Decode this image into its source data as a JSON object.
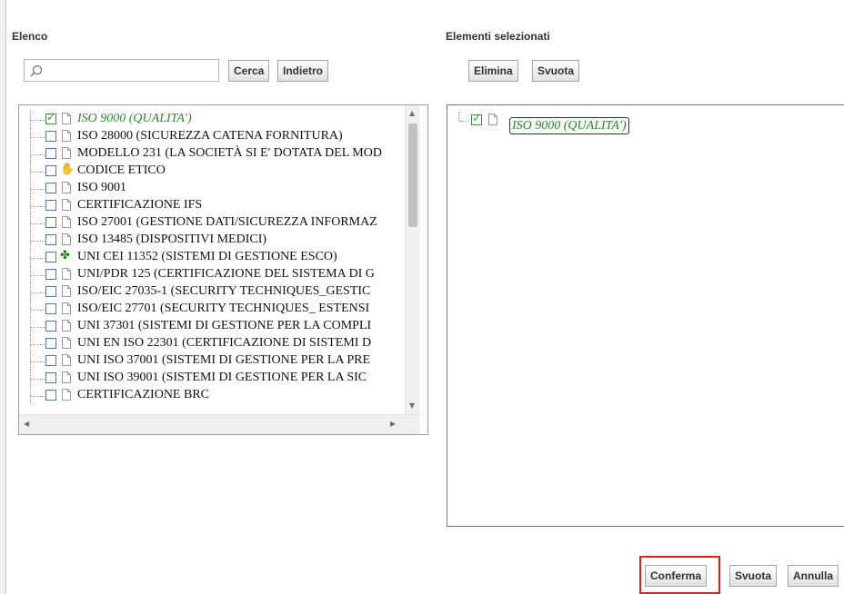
{
  "left_panel": {
    "heading": "Elenco",
    "search": {
      "value": "",
      "placeholder": ""
    },
    "buttons": {
      "search": "Cerca",
      "back": "Indietro"
    },
    "tree_items": [
      {
        "label": "ISO 9000 (QUALITA')",
        "checked": true,
        "icon": "document-icon",
        "selected": true
      },
      {
        "label": "ISO 28000 (SICUREZZA CATENA FORNITURA)",
        "checked": false,
        "icon": "document-icon"
      },
      {
        "label": "MODELLO 231 (LA SOCIETÀ SI E' DOTATA DEL MOD",
        "checked": false,
        "icon": "document-icon"
      },
      {
        "label": "CODICE ETICO",
        "checked": false,
        "icon": "hand-icon"
      },
      {
        "label": "ISO 9001",
        "checked": false,
        "icon": "document-icon"
      },
      {
        "label": "CERTIFICAZIONE IFS",
        "checked": false,
        "icon": "document-icon"
      },
      {
        "label": "ISO 27001 (GESTIONE DATI/SICUREZZA INFORMAZ",
        "checked": false,
        "icon": "document-icon"
      },
      {
        "label": "ISO 13485 (DISPOSITIVI MEDICI)",
        "checked": false,
        "icon": "document-icon"
      },
      {
        "label": "UNI CEI 11352 (SISTEMI DI GESTIONE ESCO)",
        "checked": false,
        "icon": "clover-icon"
      },
      {
        "label": "UNI/PDR 125 (CERTIFICAZIONE DEL SISTEMA DI G",
        "checked": false,
        "icon": "document-icon"
      },
      {
        "label": "ISO/EIC 27035-1 (SECURITY TECHNIQUES_GESTIC",
        "checked": false,
        "icon": "document-icon"
      },
      {
        "label": "ISO/EIC 27701 (SECURITY TECHNIQUES_ ESTENSI",
        "checked": false,
        "icon": "document-icon"
      },
      {
        "label": "UNI 37301 (SISTEMI DI GESTIONE PER LA COMPLI",
        "checked": false,
        "icon": "document-icon"
      },
      {
        "label": "UNI EN ISO 22301 (CERTIFICAZIONE DI SISTEMI D",
        "checked": false,
        "icon": "document-icon"
      },
      {
        "label": "UNI ISO 37001 (SISTEMI DI GESTIONE PER LA PRE",
        "checked": false,
        "icon": "document-icon"
      },
      {
        "label": "UNI ISO 39001 (SISTEMI DI GESTIONE PER LA SIC",
        "checked": false,
        "icon": "document-icon"
      },
      {
        "label": "CERTIFICAZIONE BRC",
        "checked": false,
        "icon": "document-icon"
      }
    ]
  },
  "right_panel": {
    "heading": "Elementi selezionati",
    "buttons": {
      "remove": "Elimina",
      "clear": "Svuota"
    },
    "selected_items": [
      {
        "label": "ISO 9000 (QUALITA')",
        "checked": true,
        "icon": "document-icon"
      }
    ]
  },
  "footer": {
    "confirm": "Conferma",
    "clear": "Svuota",
    "cancel": "Annulla"
  },
  "colors": {
    "selected_text": "#2f8a2f",
    "highlight_frame": "#e01e1e",
    "checkbox_border": "#4a7ab6"
  }
}
